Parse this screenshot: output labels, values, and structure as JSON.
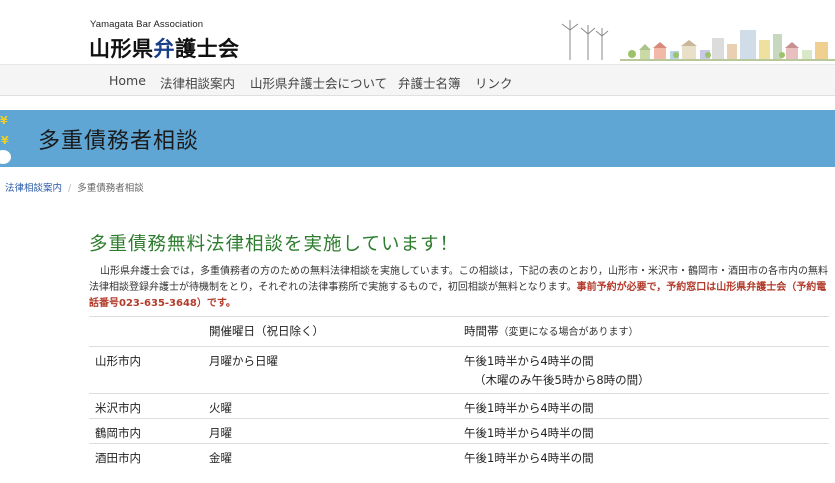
{
  "header": {
    "subtitle": "Yamagata Bar Association",
    "title_part1": "山形県",
    "title_accent": "弁",
    "title_part2": "護士会"
  },
  "nav": {
    "items": [
      "Home",
      "法律相談案内",
      "山形県弁護士会について",
      "弁護士名簿",
      "リンク"
    ]
  },
  "banner": {
    "title": "多重債務者相談"
  },
  "breadcrumb": {
    "parent": "法律相談案内",
    "separator": "/",
    "current": "多重債務者相談"
  },
  "content": {
    "headline": "多重債務無料法律相談を実施しています！",
    "intro_text": "山形県弁護士会では，多重債務者の方のための無料法律相談を実施しています。この相談は，下記の表のとおり，山形市・米沢市・鶴岡市・酒田市の各市内の無料法律相談登録弁護士が待機制をとり，それぞれの法律事務所で実施するもので，初回相談が無料となります。",
    "intro_warn": "事前予約が必要で，予約窓口は山形県弁護士会（予約電話番号023-635-3648）です。"
  },
  "table": {
    "headers": {
      "place": "",
      "days": "開催曜日（祝日除く）",
      "time": "時間帯",
      "time_note": "（変更になる場合があります）"
    },
    "rows": [
      {
        "place": "山形市内",
        "days": "月曜から日曜",
        "time": "午後1時半から4時半の間",
        "time_extra": "（木曜のみ午後5時から8時の間）"
      },
      {
        "place": "米沢市内",
        "days": "火曜",
        "time": "午後1時半から4時半の間"
      },
      {
        "place": "鶴岡市内",
        "days": "月曜",
        "time": "午後1時半から4時半の間"
      },
      {
        "place": "酒田市内",
        "days": "金曜",
        "time": "午後1時半から4時半の間"
      }
    ]
  },
  "colors": {
    "banner": "#5fa6d5",
    "headline": "#2e7d2e",
    "warning": "#b23b2a",
    "link": "#2a5aa8",
    "title_accent": "#1a3f8a"
  }
}
